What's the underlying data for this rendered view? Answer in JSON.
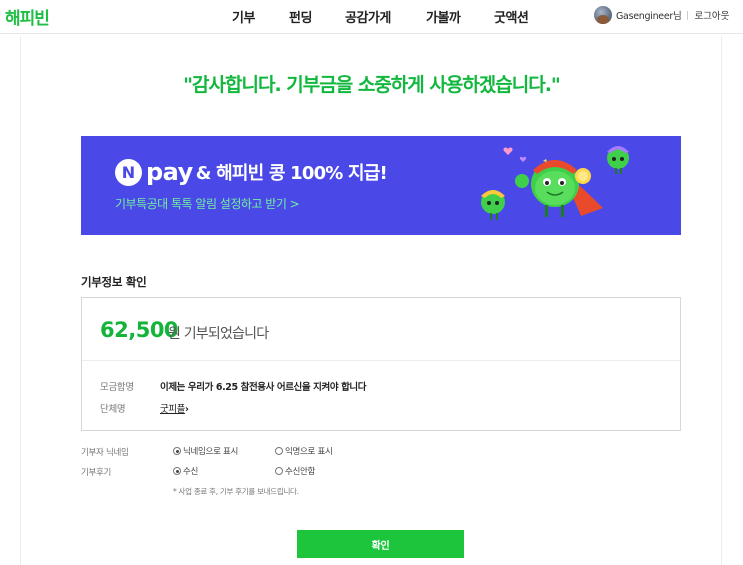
{
  "header": {
    "logo": "해피빈",
    "nav": [
      "기부",
      "펀딩",
      "공감가게",
      "가볼까",
      "굿액션"
    ],
    "username": "Gasengineer님",
    "logout": "로그아웃"
  },
  "thanks_message": "\"감사합니다. 기부금을 소중하게 사용하겠습니다.\"",
  "banner": {
    "npay_letter": "N",
    "pay_text": "pay",
    "title": "& 해피빈 콩 100% 지급!",
    "subtitle": "기부특공대 톡톡 알림 설정하고 받기 >",
    "background": "#4a49e8"
  },
  "info": {
    "section_title": "기부정보 확인",
    "amount": "62,500",
    "amount_suffix": "원 기부되었습니다",
    "campaign_label": "모금함명",
    "campaign_value": "이제는 우리가 6.25 참전용사 어르신을 지켜야 합니다",
    "org_label": "단체명",
    "org_value": "굿피플",
    "org_arrow": "›"
  },
  "options": {
    "nickname_label": "기부자 닉네임",
    "nickname_choices": [
      "닉네임으로 표시",
      "익명으로 표시"
    ],
    "nickname_selected": 0,
    "review_label": "기부후기",
    "review_choices": [
      "수신",
      "수신안함"
    ],
    "review_selected": 0,
    "note": "* 사업 종료 후, 기부 후기를 보내드립니다."
  },
  "confirm_button": "확인",
  "colors": {
    "brand_green": "#1cc53c",
    "amount_green": "#14b33a",
    "banner_blue": "#4a49e8",
    "banner_sub_green": "#72f0a0"
  }
}
